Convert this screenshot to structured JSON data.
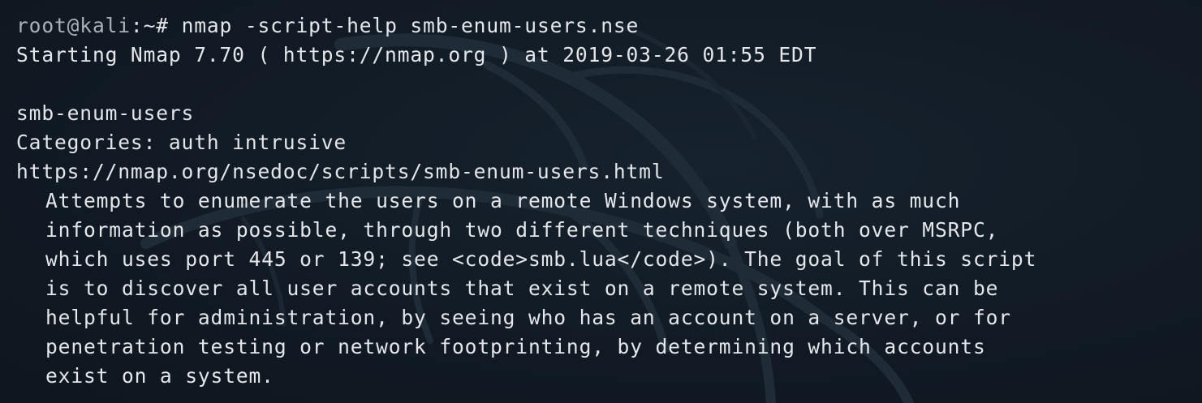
{
  "terminal": {
    "prompt": {
      "user_host": "root@kali",
      "path": ":~",
      "symbol": "# ",
      "command": "nmap -script-help smb-enum-users.nse"
    },
    "output": {
      "start_line": "Starting Nmap 7.70 ( https://nmap.org ) at 2019-03-26 01:55 EDT",
      "blank": "",
      "script_name": "smb-enum-users",
      "categories": "Categories: auth intrusive",
      "doc_url": "https://nmap.org/nsedoc/scripts/smb-enum-users.html",
      "description": [
        "Attempts to enumerate the users on a remote Windows system, with as much",
        "information as possible, through two different techniques (both over MSRPC,",
        "which uses port 445 or 139; see <code>smb.lua</code>). The goal of this script",
        "is to discover all user accounts that exist on a remote system. This can be",
        "helpful for administration, by seeing who has an account on a server, or for",
        "penetration testing or network footprinting, by determining which accounts",
        "exist on a system."
      ]
    }
  }
}
